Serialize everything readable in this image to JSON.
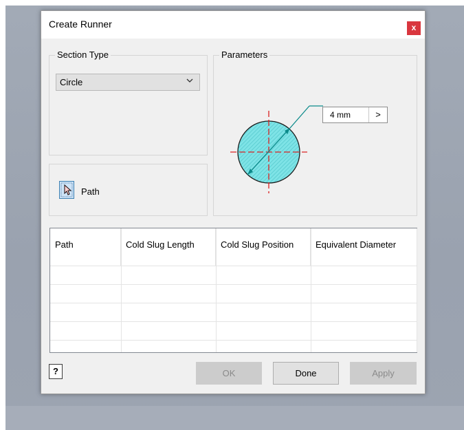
{
  "dialog": {
    "title": "Create Runner",
    "close_label": "x"
  },
  "section_type": {
    "group_label": "Section Type",
    "selected": "Circle"
  },
  "parameters": {
    "group_label": "Parameters",
    "diameter_value": "4 mm",
    "arrow_label": ">"
  },
  "path": {
    "label": "Path"
  },
  "table": {
    "columns": [
      "Path",
      "Cold Slug Length",
      "Cold Slug Position",
      "Equivalent Diameter"
    ]
  },
  "footer": {
    "help_label": "?",
    "ok_label": "OK",
    "done_label": "Done",
    "apply_label": "Apply"
  },
  "colors": {
    "circle_fill": "#7ee3e6",
    "centerline": "#d92020",
    "dimension": "#0b8a8a",
    "close_button": "#d9363e"
  },
  "icons": {
    "path_select": "pointer-arrow-icon",
    "dropdown": "chevron-down-icon",
    "help": "help-icon"
  }
}
